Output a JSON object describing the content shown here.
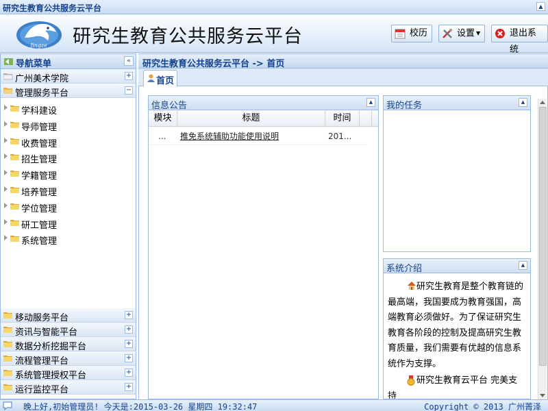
{
  "window": {
    "title": "研究生教育公共服务云平台"
  },
  "header": {
    "logo_text": "Jingze",
    "title": "研究生教育公共服务云平台",
    "buttons": {
      "calendar": "校历",
      "settings": "设置",
      "logout": "退出系统"
    }
  },
  "nav": {
    "title": "导航菜单",
    "top_sections": [
      {
        "label": "广州美术学院",
        "toggle": "+"
      },
      {
        "label": "管理服务平台",
        "toggle": "−"
      }
    ],
    "tree": [
      "学科建设",
      "导师管理",
      "收费管理",
      "招生管理",
      "学籍管理",
      "培养管理",
      "学位管理",
      "研工管理",
      "系统管理"
    ],
    "bottom_sections": [
      "移动服务平台",
      "资讯与智能平台",
      "数据分析挖掘平台",
      "流程管理平台",
      "系统管理授权平台",
      "运行监控平台"
    ]
  },
  "breadcrumb": "研究生教育公共服务云平台 -> 首页",
  "tabs": [
    {
      "label": "首页"
    }
  ],
  "notice_panel": {
    "title": "信息公告",
    "columns": [
      "模块",
      "标题",
      "时间"
    ],
    "rows": [
      {
        "module": "...",
        "title": "推免系统辅助功能使用说明",
        "time": "201..."
      }
    ]
  },
  "tasks_panel": {
    "title": "我的任务"
  },
  "intro_panel": {
    "title": "系统介绍",
    "text1": "研究生教育是整个教育链的最高端，我国要成为教育强国，高端教育必须做好。为了保证研究生教育各阶段的控制及提高研究生教育质量，我们需要有优越的信息系统作为支撑。",
    "text2": "研究生教育云平台 完美支持"
  },
  "footer": {
    "greeting": "晚上好,初始管理员! 今天是:2015-03-26 星期四 19:32:47",
    "copyright": "Copyright © 2013 广州菁泽"
  },
  "colors": {
    "accent": "#15428b",
    "border": "#99bbe8",
    "header_bg": "#d4e4f6"
  }
}
